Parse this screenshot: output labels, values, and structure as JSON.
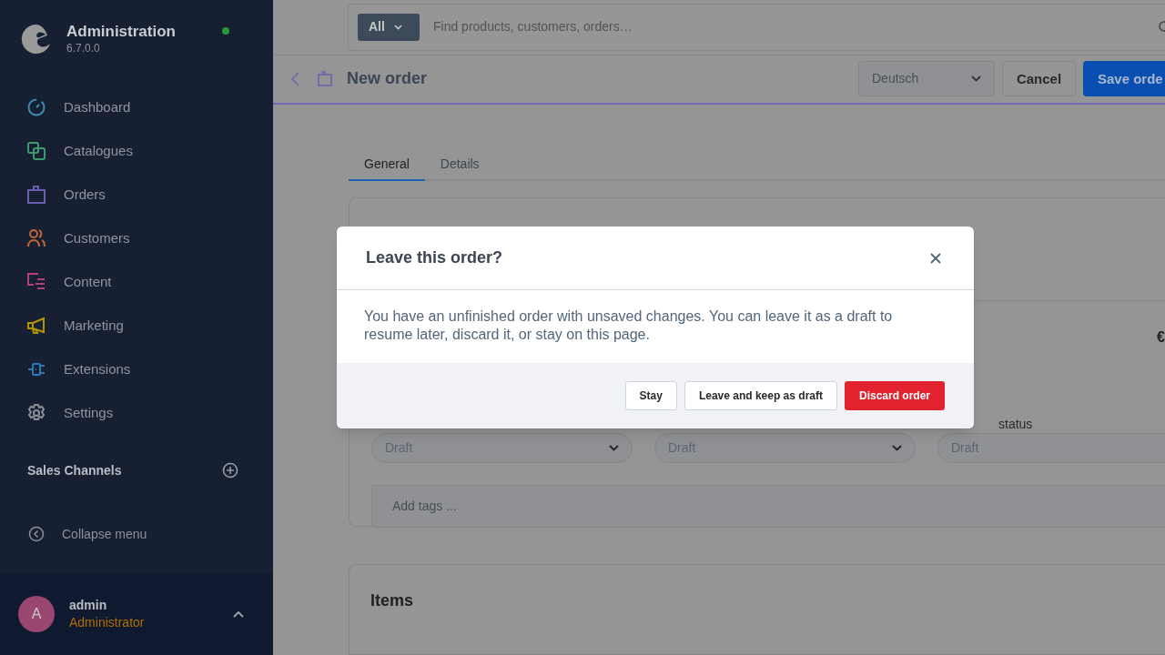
{
  "app": {
    "title": "Administration",
    "version": "6.7.0.0",
    "online": true
  },
  "nav": [
    {
      "label": "Dashboard",
      "color": "#3a8db0"
    },
    {
      "label": "Catalogues",
      "color": "#3e9a6c"
    },
    {
      "label": "Orders",
      "color": "#6a5fb0"
    },
    {
      "label": "Customers",
      "color": "#c0663a"
    },
    {
      "label": "Content",
      "color": "#b5407a"
    },
    {
      "label": "Marketing",
      "color": "#b29400"
    },
    {
      "label": "Extensions",
      "color": "#2a78b8"
    },
    {
      "label": "Settings",
      "color": "#8a8f99"
    }
  ],
  "sales_channels": {
    "title": "Sales Channels"
  },
  "collapse": "Collapse menu",
  "user": {
    "initial": "A",
    "name": "admin",
    "role": "Administrator"
  },
  "search": {
    "scope": "All",
    "placeholder": "Find products, customers, orders…"
  },
  "header": {
    "title": "New order",
    "language": "Deutsch",
    "cancel": "Cancel",
    "save": "Save orde"
  },
  "tabs": [
    {
      "label": "General",
      "selected": true
    },
    {
      "label": "Details",
      "selected": false
    }
  ],
  "amount": "€",
  "statuses": [
    {
      "value": "Draft"
    },
    {
      "value": "Draft"
    },
    {
      "label": "status",
      "value": "Draft"
    }
  ],
  "tags_placeholder": "Add tags ...",
  "items_title": "Items",
  "modal": {
    "title": "Leave this order?",
    "message": "You have an unfinished order with unsaved changes. You can leave it as a draft to resume later, discard it, or stay on this page.",
    "buttons": [
      {
        "label": "Stay",
        "kind": "secondary"
      },
      {
        "label": "Leave and keep as draft",
        "kind": "secondary"
      },
      {
        "label": "Discard order",
        "kind": "danger"
      }
    ]
  }
}
